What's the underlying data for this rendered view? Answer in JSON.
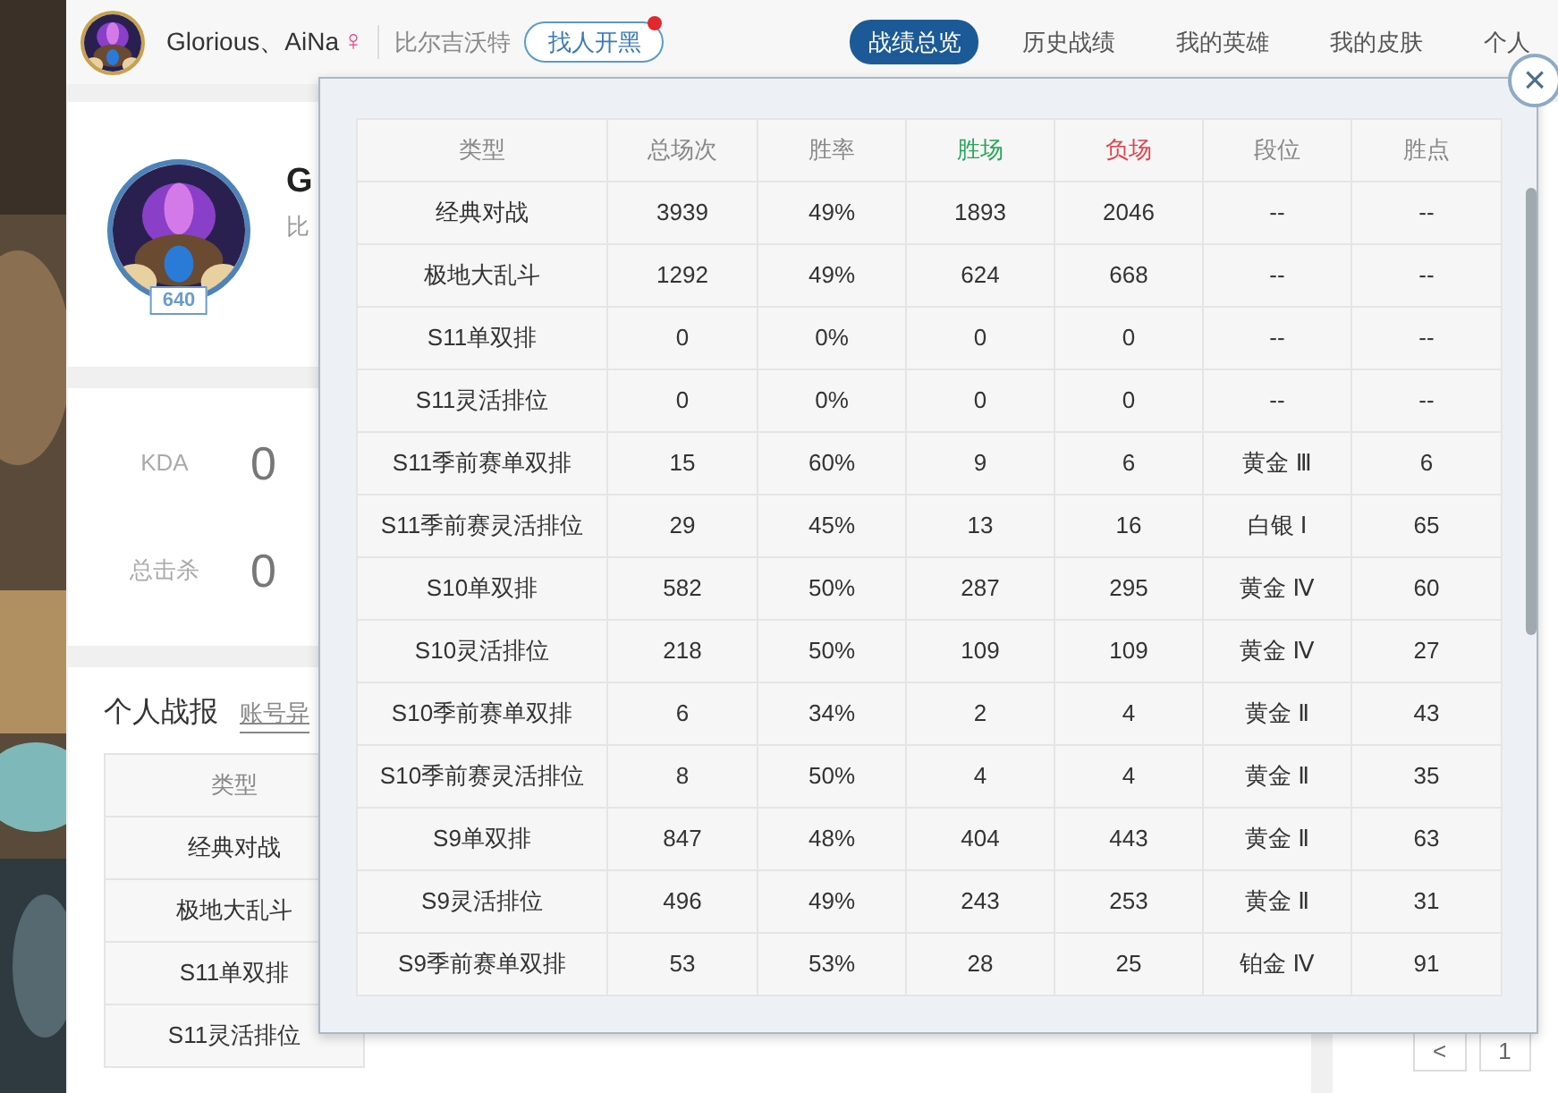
{
  "header": {
    "player_name": "Glorious、AiNa",
    "gender_symbol": "♀",
    "server": "比尔吉沃特",
    "team_button": "找人开黑",
    "team_button_notice": true,
    "tabs": [
      {
        "label": "战绩总览",
        "selected": true
      },
      {
        "label": "历史战绩",
        "selected": false
      },
      {
        "label": "我的英雄",
        "selected": false
      },
      {
        "label": "我的皮肤",
        "selected": false
      },
      {
        "label": "个人",
        "selected": false
      }
    ]
  },
  "profile": {
    "level": "640",
    "name": "G",
    "server": "比"
  },
  "stats": [
    {
      "label": "KDA",
      "value": "0"
    },
    {
      "label": "总击杀",
      "value": "0"
    }
  ],
  "report": {
    "title": "个人战报",
    "link": "账号异",
    "column": "类型",
    "rows": [
      "经典对战",
      "极地大乱斗",
      "S11单双排",
      "S11灵活排位"
    ]
  },
  "side": {
    "pager": [
      "<",
      "1"
    ]
  },
  "modal": {
    "close": "×",
    "columns": [
      {
        "label": "类型",
        "kind": "plain"
      },
      {
        "label": "总场次",
        "kind": "plain"
      },
      {
        "label": "胜率",
        "kind": "plain"
      },
      {
        "label": "胜场",
        "kind": "win"
      },
      {
        "label": "负场",
        "kind": "loss"
      },
      {
        "label": "段位",
        "kind": "plain"
      },
      {
        "label": "胜点",
        "kind": "plain"
      }
    ],
    "rows": [
      [
        "经典对战",
        "3939",
        "49%",
        "1893",
        "2046",
        "--",
        "--"
      ],
      [
        "极地大乱斗",
        "1292",
        "49%",
        "624",
        "668",
        "--",
        "--"
      ],
      [
        "S11单双排",
        "0",
        "0%",
        "0",
        "0",
        "--",
        "--"
      ],
      [
        "S11灵活排位",
        "0",
        "0%",
        "0",
        "0",
        "--",
        "--"
      ],
      [
        "S11季前赛单双排",
        "15",
        "60%",
        "9",
        "6",
        "黄金 Ⅲ",
        "6"
      ],
      [
        "S11季前赛灵活排位",
        "29",
        "45%",
        "13",
        "16",
        "白银 Ⅰ",
        "65"
      ],
      [
        "S10单双排",
        "582",
        "50%",
        "287",
        "295",
        "黄金 Ⅳ",
        "60"
      ],
      [
        "S10灵活排位",
        "218",
        "50%",
        "109",
        "109",
        "黄金 Ⅳ",
        "27"
      ],
      [
        "S10季前赛单双排",
        "6",
        "34%",
        "2",
        "4",
        "黄金 Ⅱ",
        "43"
      ],
      [
        "S10季前赛灵活排位",
        "8",
        "50%",
        "4",
        "4",
        "黄金 Ⅱ",
        "35"
      ],
      [
        "S9单双排",
        "847",
        "48%",
        "404",
        "443",
        "黄金 Ⅱ",
        "63"
      ],
      [
        "S9灵活排位",
        "496",
        "49%",
        "243",
        "253",
        "黄金 Ⅱ",
        "31"
      ],
      [
        "S9季前赛单双排",
        "53",
        "53%",
        "28",
        "25",
        "铂金 Ⅳ",
        "91"
      ]
    ]
  }
}
